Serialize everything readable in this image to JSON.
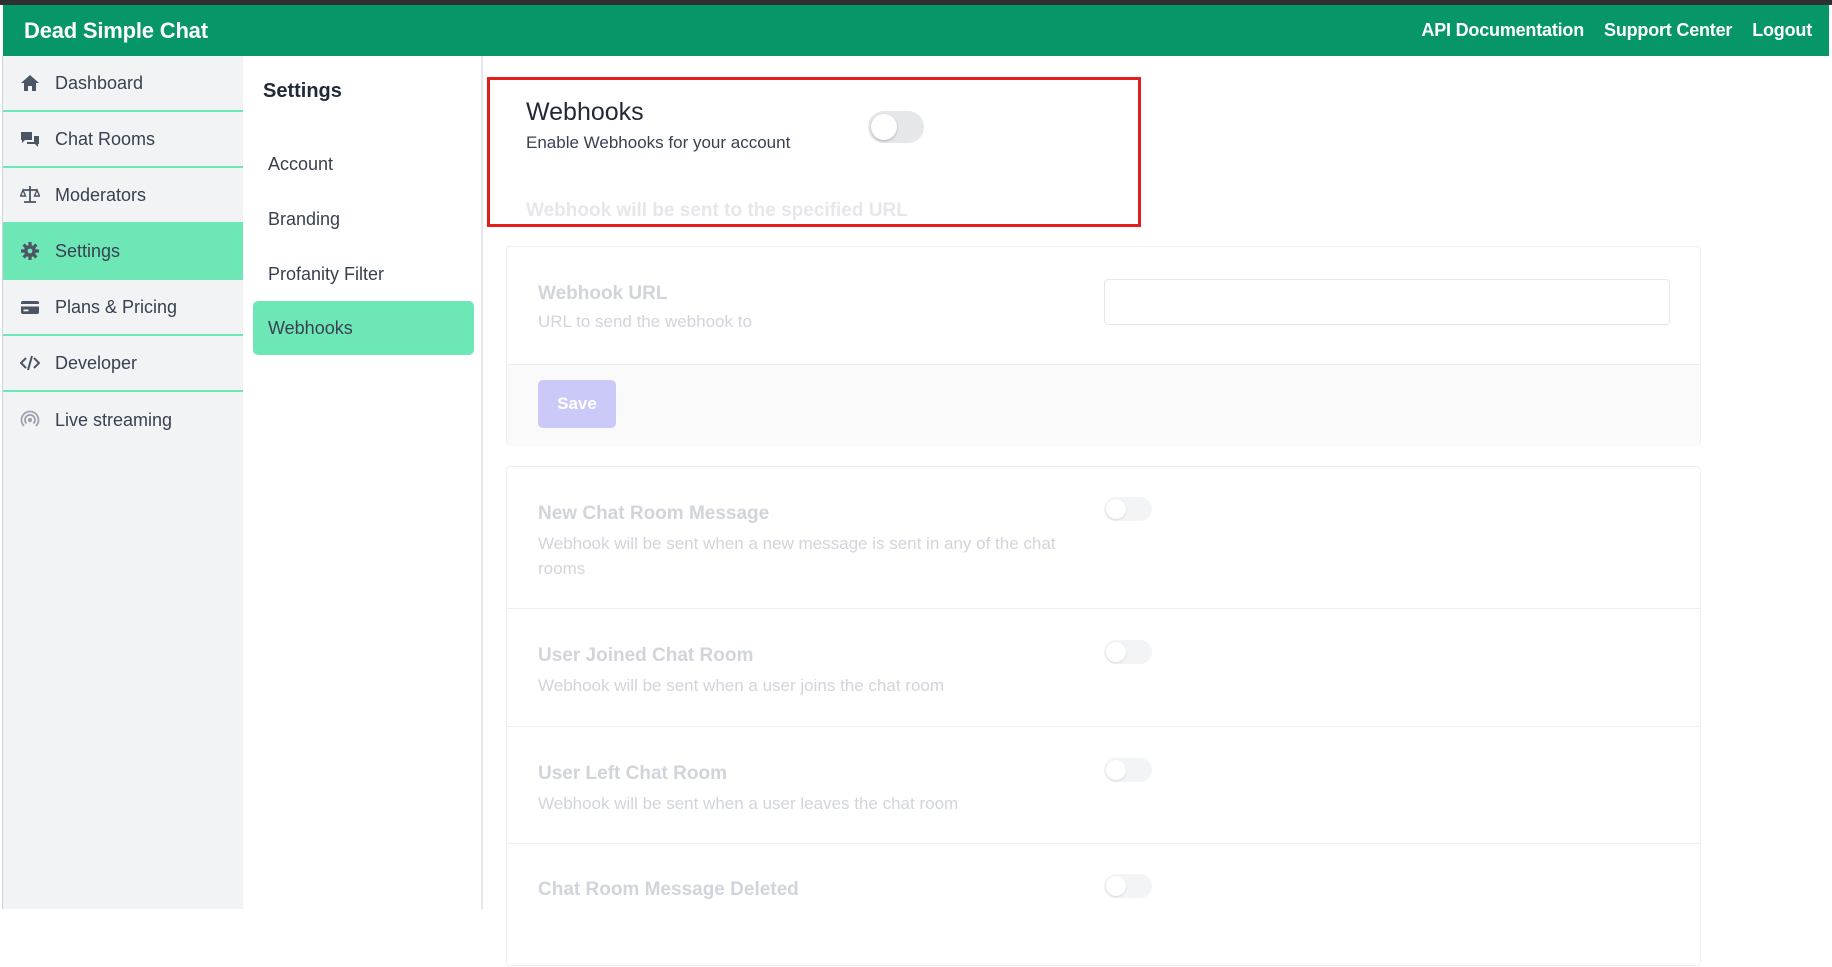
{
  "header": {
    "brand": "Dead Simple Chat",
    "links": [
      "API Documentation",
      "Support Center",
      "Logout"
    ]
  },
  "sidebar": {
    "items": [
      {
        "label": "Dashboard",
        "icon": "home-icon"
      },
      {
        "label": "Chat Rooms",
        "icon": "chat-bubbles-icon"
      },
      {
        "label": "Moderators",
        "icon": "scale-icon"
      },
      {
        "label": "Settings",
        "icon": "gear-icon",
        "active": true
      },
      {
        "label": "Plans & Pricing",
        "icon": "credit-card-icon"
      },
      {
        "label": "Developer",
        "icon": "code-icon"
      },
      {
        "label": "Live streaming",
        "icon": "broadcast-icon"
      }
    ]
  },
  "settings_nav": {
    "title": "Settings",
    "items": [
      {
        "label": "Account"
      },
      {
        "label": "Branding"
      },
      {
        "label": "Profanity Filter"
      },
      {
        "label": "Webhooks",
        "active": true
      }
    ]
  },
  "webhooks": {
    "title": "Webhooks",
    "description": "Enable Webhooks for your account",
    "enabled": false,
    "note": "Webhook will be sent to the specified URL",
    "url_field": {
      "label": "Webhook URL",
      "description": "URL to send the webhook to",
      "value": ""
    },
    "save_label": "Save",
    "events": [
      {
        "title": "New Chat Room Message",
        "description": "Webhook will be sent when a new message is sent in any of the chat rooms",
        "enabled": false
      },
      {
        "title": "User Joined Chat Room",
        "description": "Webhook will be sent when a user joins the chat room",
        "enabled": false
      },
      {
        "title": "User Left Chat Room",
        "description": "Webhook will be sent when a user leaves the chat room",
        "enabled": false
      },
      {
        "title": "Chat Room Message Deleted",
        "description": "",
        "enabled": false
      }
    ]
  },
  "colors": {
    "brand_green": "#069668",
    "active_mint": "#6ee7b7",
    "highlight_red": "#e11d1d",
    "save_button_disabled": "#cbc9f7"
  }
}
